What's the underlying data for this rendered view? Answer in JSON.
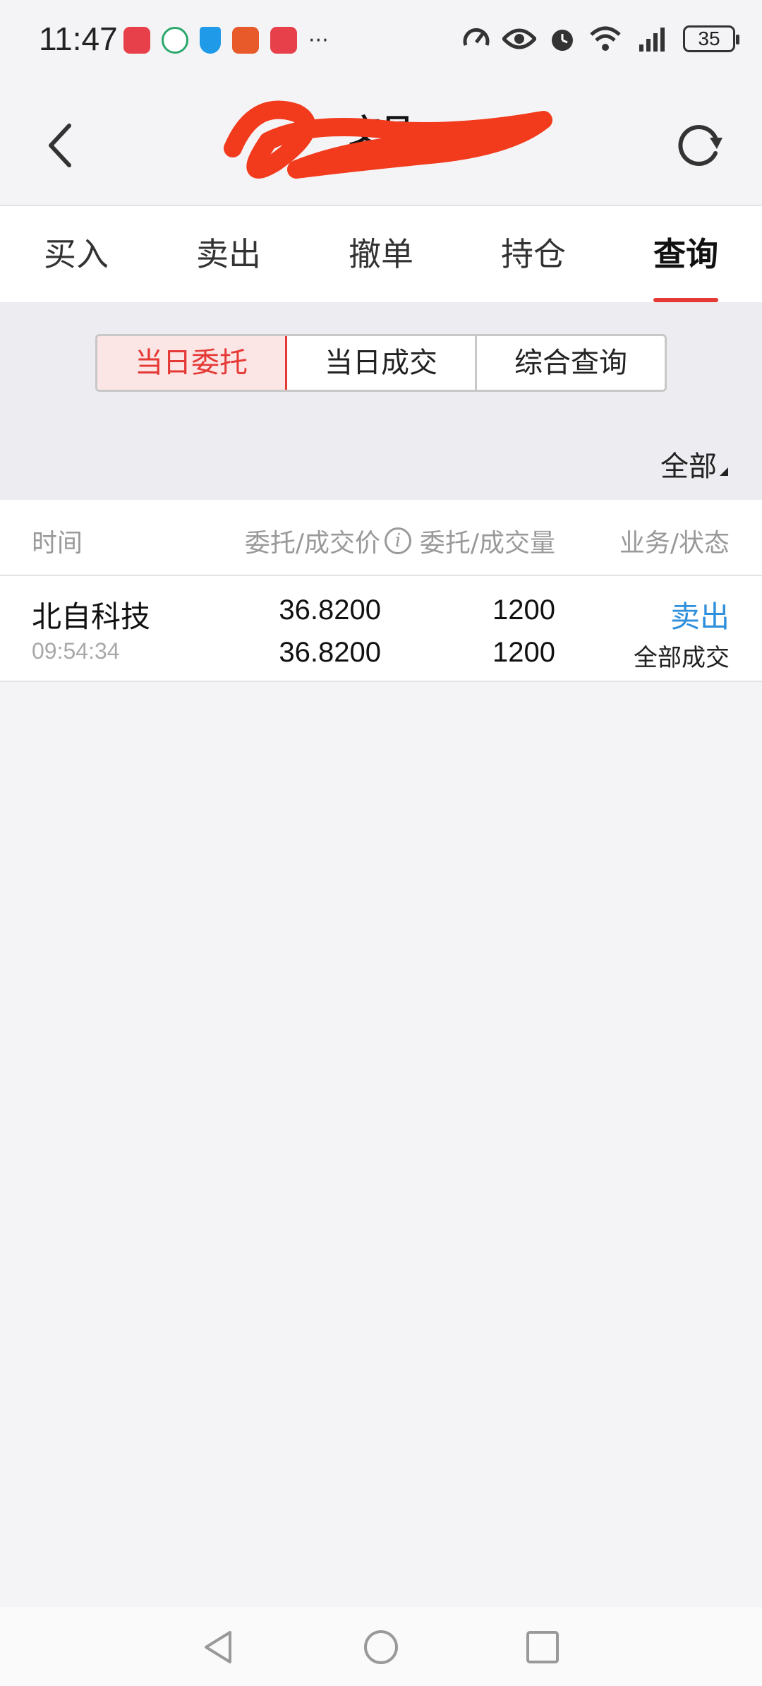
{
  "status_bar": {
    "time": "11:47",
    "battery": "35",
    "notification_icons": [
      "huawei-store-icon",
      "app-icon",
      "shield-icon",
      "securities-app-icon",
      "huawei-store-icon"
    ],
    "more": "···",
    "system_icons": [
      "speed-icon",
      "eye-icon",
      "alarm-icon",
      "wifi-icon",
      "4g-signal-icon"
    ]
  },
  "header": {
    "title": "交易"
  },
  "tabs": [
    {
      "label": "买入",
      "active": false
    },
    {
      "label": "卖出",
      "active": false
    },
    {
      "label": "撤单",
      "active": false
    },
    {
      "label": "持仓",
      "active": false
    },
    {
      "label": "查询",
      "active": true
    }
  ],
  "segments": [
    {
      "label": "当日委托",
      "active": true
    },
    {
      "label": "当日成交",
      "active": false
    },
    {
      "label": "综合查询",
      "active": false
    }
  ],
  "filter": {
    "label": "全部"
  },
  "table": {
    "columns": [
      "时间",
      "委托/成交价",
      "委托/成交量",
      "业务/状态"
    ],
    "rows": [
      {
        "name": "北自科技",
        "time": "09:54:34",
        "order_price": "36.8200",
        "deal_price": "36.8200",
        "order_qty": "1200",
        "deal_qty": "1200",
        "action": "卖出",
        "status": "全部成交"
      }
    ]
  },
  "colors": {
    "accent_red": "#e53935",
    "action_blue": "#2e8fdc",
    "background": "#f4f4f6"
  }
}
